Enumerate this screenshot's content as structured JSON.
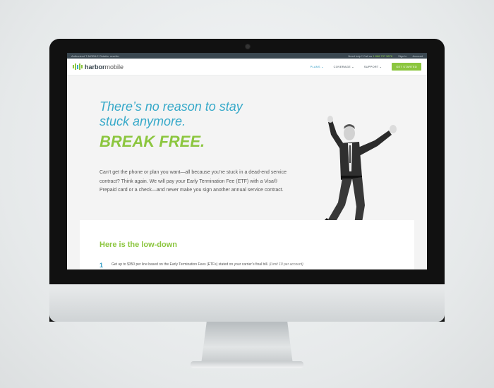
{
  "topbar": {
    "left_text": "Authorized T-MOBILE Retailer reseller",
    "need_help": "Need help? Call us",
    "phone": "1 866 737 5876",
    "sign_in": "Sign In",
    "account": "Account"
  },
  "brand": {
    "name_bold": "harbor",
    "name_light": "mobile"
  },
  "nav": {
    "items": [
      {
        "label": "PLANS ⌄"
      },
      {
        "label": "COVERAGE ⌄"
      },
      {
        "label": "SUPPORT ⌄"
      }
    ],
    "cta": "GET STARTED"
  },
  "hero": {
    "headline_line1": "There’s no reason to stay",
    "headline_line2": "stuck anymore.",
    "tagline": "BREAK FREE.",
    "body": "Can’t get the phone or plan you want—all because you’re stuck in a dead-end service contract? Think again. We will pay your Early Termination Fee (ETF) with a Visa® Prepaid card or a check—and never make you sign another annual service contract."
  },
  "lowdown": {
    "title": "Here is the low-down",
    "steps": [
      {
        "number": "1",
        "text": "Get up to $350 per line based on the Early Termination Fees (ETFs) stated on your carrier’s final bill.",
        "note": "(Limit 10 per account)"
      }
    ]
  },
  "colors": {
    "accent_green": "#8cc63f",
    "accent_blue": "#36a9c9",
    "topbar": "#3a4750"
  },
  "icons": [
    "harbor-mobile-logo-icon",
    "camera-icon"
  ]
}
